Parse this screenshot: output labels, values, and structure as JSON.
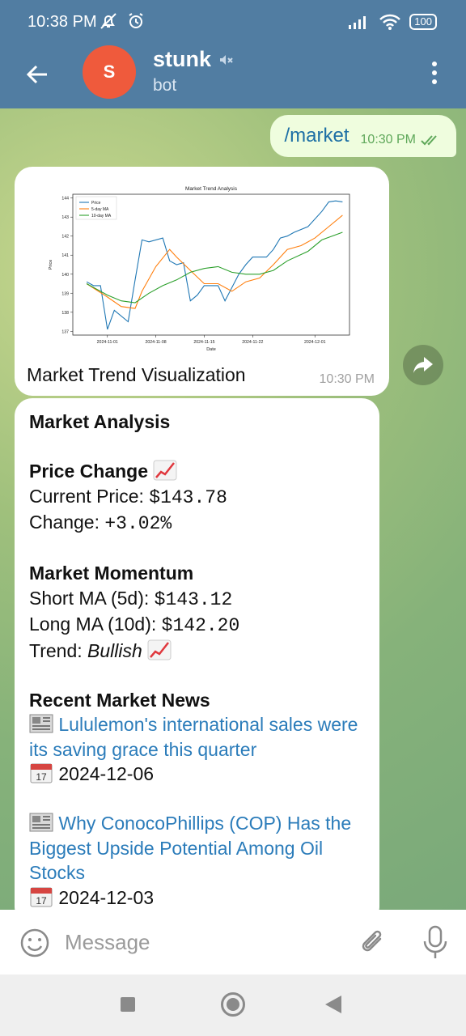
{
  "status_bar": {
    "time": "10:38 PM",
    "battery": "100"
  },
  "header": {
    "title": "stunk",
    "subtitle": "bot",
    "avatar_letter": "S"
  },
  "messages": {
    "outgoing": {
      "text": "/market",
      "time": "10:30 PM"
    },
    "image": {
      "caption": "Market Trend Visualization",
      "time": "10:30 PM"
    },
    "analysis": {
      "title": "Market Analysis",
      "price_heading": "Price Change",
      "current_price_label": "Current Price: ",
      "current_price_value": "$143.78",
      "change_label": "Change: ",
      "change_value": "+3.02%",
      "momentum_heading": "Market Momentum",
      "short_ma_label": "Short MA (5d): ",
      "short_ma_value": "$143.12",
      "long_ma_label": "Long MA (10d): ",
      "long_ma_value": "$142.20",
      "trend_label": "Trend: ",
      "trend_value": "Bullish",
      "news_heading": "Recent Market News",
      "news": [
        {
          "headline": "Lululemon's international sales were its saving grace this quarter",
          "date": "2024-12-06"
        },
        {
          "headline": "Why ConocoPhillips (COP) Has the Biggest Upside Potential Among Oil Stocks",
          "date": "2024-12-03"
        }
      ]
    }
  },
  "input": {
    "placeholder": "Message"
  },
  "colors": {
    "accent": "#517da2",
    "link": "#2b7cba",
    "price": "#1f77b4",
    "ma5": "#ff7f0e",
    "ma10": "#2ca02c"
  },
  "chart_data": {
    "type": "line",
    "title": "Market Trend Analysis",
    "xlabel": "Date",
    "ylabel": "Price",
    "ylim": [
      136.8,
      144.2
    ],
    "xlim": [
      "2024-10-27",
      "2024-12-06"
    ],
    "yticks": [
      137,
      138,
      139,
      140,
      141,
      142,
      143,
      144
    ],
    "xticks": [
      "2024-11-01",
      "2024-11-08",
      "2024-11-15",
      "2024-11-22",
      "2024-12-01"
    ],
    "legend": "top-left",
    "series": [
      {
        "name": "Price",
        "x": [
          "2024-10-29",
          "2024-10-30",
          "2024-10-31",
          "2024-11-01",
          "2024-11-02",
          "2024-11-04",
          "2024-11-05",
          "2024-11-06",
          "2024-11-07",
          "2024-11-09",
          "2024-11-10",
          "2024-11-11",
          "2024-11-12",
          "2024-11-13",
          "2024-11-14",
          "2024-11-15",
          "2024-11-17",
          "2024-11-18",
          "2024-11-20",
          "2024-11-21",
          "2024-11-22",
          "2024-11-24",
          "2024-11-25",
          "2024-11-26",
          "2024-11-27",
          "2024-11-28",
          "2024-11-30",
          "2024-12-02",
          "2024-12-03",
          "2024-12-04",
          "2024-12-05"
        ],
        "y": [
          139.6,
          139.4,
          139.4,
          137.1,
          138.1,
          137.5,
          139.7,
          141.8,
          141.7,
          141.9,
          140.7,
          140.5,
          140.6,
          138.6,
          138.9,
          139.4,
          139.4,
          138.6,
          140.0,
          140.5,
          140.9,
          140.9,
          141.3,
          141.9,
          142.0,
          142.2,
          142.5,
          143.3,
          143.8,
          143.85,
          143.8
        ]
      },
      {
        "name": "5-day MA",
        "x": [
          "2024-10-29",
          "2024-11-01",
          "2024-11-03",
          "2024-11-05",
          "2024-11-06",
          "2024-11-08",
          "2024-11-10",
          "2024-11-11",
          "2024-11-13",
          "2024-11-15",
          "2024-11-17",
          "2024-11-19",
          "2024-11-21",
          "2024-11-23",
          "2024-11-25",
          "2024-11-27",
          "2024-11-29",
          "2024-12-01",
          "2024-12-03",
          "2024-12-05"
        ],
        "y": [
          139.5,
          138.8,
          138.3,
          138.2,
          139.1,
          140.4,
          141.3,
          140.9,
          140.2,
          139.5,
          139.5,
          139.1,
          139.6,
          139.8,
          140.5,
          141.3,
          141.5,
          141.9,
          142.5,
          143.1
        ]
      },
      {
        "name": "10-day MA",
        "x": [
          "2024-10-29",
          "2024-11-01",
          "2024-11-03",
          "2024-11-05",
          "2024-11-07",
          "2024-11-09",
          "2024-11-11",
          "2024-11-13",
          "2024-11-15",
          "2024-11-17",
          "2024-11-19",
          "2024-11-21",
          "2024-11-23",
          "2024-11-25",
          "2024-11-27",
          "2024-11-30",
          "2024-12-02",
          "2024-12-05"
        ],
        "y": [
          139.5,
          138.9,
          138.6,
          138.5,
          139.0,
          139.4,
          139.7,
          140.1,
          140.3,
          140.4,
          140.1,
          140.0,
          140.0,
          140.2,
          140.7,
          141.2,
          141.8,
          142.2
        ]
      }
    ]
  }
}
